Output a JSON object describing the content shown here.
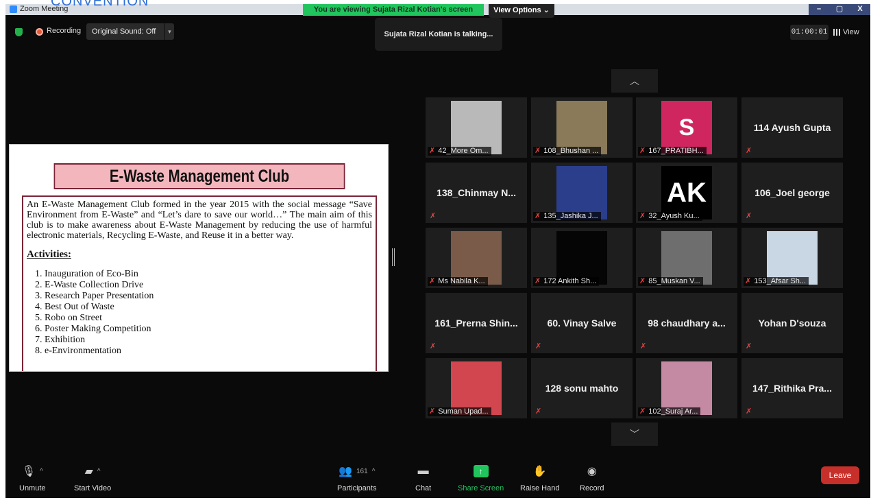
{
  "overlay_text": "CONVENTION",
  "window": {
    "app_title": "Zoom Meeting",
    "viewing_banner": "You are viewing Sujata Rizal Kotian's screen",
    "view_options": "View Options ⌄",
    "controls": [
      "–",
      "▢",
      "X"
    ]
  },
  "topbar": {
    "recording": "Recording",
    "original_sound": "Original Sound: Off",
    "caret": "▾",
    "talking": "Sujata Rizal Kotian is talking...",
    "timer": "01:00:01",
    "view": "View"
  },
  "slide": {
    "title": "E-Waste Management Club",
    "intro": "An E-Waste Management Club formed in the year 2015 with the social message “Save Environment from E-Waste” and “Let’s dare to save our world…” The main aim of this club is to make awareness about E-Waste Management by reducing the use of harmful electronic materials, Recycling E-Waste, and Reuse it in a better way.",
    "activities_heading": "Activities:",
    "activities": [
      "Inauguration of Eco-Bin",
      "E-Waste Collection Drive",
      "Research Paper Presentation",
      "Best Out of Waste",
      "Robo on Street",
      "Poster Making Competition",
      "Exhibition",
      "e-Environmentation"
    ]
  },
  "gallery": {
    "up_arrow": "︿",
    "down_arrow": "﹀",
    "mute_glyph": "✗",
    "tiles": [
      {
        "name": "42_More Om...",
        "has_video": true,
        "thumb_color": "#b9b9b9"
      },
      {
        "name": "108_Bhushan ...",
        "has_video": true,
        "thumb_color": "#8a7a5a"
      },
      {
        "name": "167_PRATIBH...",
        "has_video": true,
        "thumb_color": "#d0265f",
        "initial": "S"
      },
      {
        "name": "114 Ayush Gupta",
        "has_video": false
      },
      {
        "name": "138_Chinmay N...",
        "has_video": false
      },
      {
        "name": "135_Jashika J...",
        "has_video": true,
        "thumb_color": "#2b3e8c"
      },
      {
        "name": "32_Ayush Ku...",
        "has_video": true,
        "thumb_color": "#000000",
        "initial": "AK"
      },
      {
        "name": "106_Joel george",
        "has_video": false
      },
      {
        "name": "Ms Nabila K...",
        "has_video": true,
        "thumb_color": "#7a5a48"
      },
      {
        "name": "172 Ankith Sh...",
        "has_video": true,
        "thumb_color": "#050505"
      },
      {
        "name": "85_Muskan V...",
        "has_video": true,
        "thumb_color": "#6e6e6e"
      },
      {
        "name": "153_Afsar Sh...",
        "has_video": true,
        "thumb_color": "#c9d6e4"
      },
      {
        "name": "161_Prerna Shin...",
        "has_video": false
      },
      {
        "name": "60. Vinay Salve",
        "has_video": false
      },
      {
        "name": "98 chaudhary a...",
        "has_video": false
      },
      {
        "name": "Yohan D'souza",
        "has_video": false
      },
      {
        "name": "Suman Upad...",
        "has_video": true,
        "thumb_color": "#d1464f"
      },
      {
        "name": "128 sonu mahto",
        "has_video": false
      },
      {
        "name": "102_Suraj Ar...",
        "has_video": true,
        "thumb_color": "#c48aa3"
      },
      {
        "name": "147_Rithika Pra...",
        "has_video": false
      }
    ]
  },
  "toolbar": {
    "unmute": "Unmute",
    "start_video": "Start Video",
    "participants": "Participants",
    "participant_count": "161",
    "chat": "Chat",
    "share_screen": "Share Screen",
    "raise_hand": "Raise Hand",
    "record": "Record",
    "leave": "Leave",
    "caret_up": "^"
  }
}
